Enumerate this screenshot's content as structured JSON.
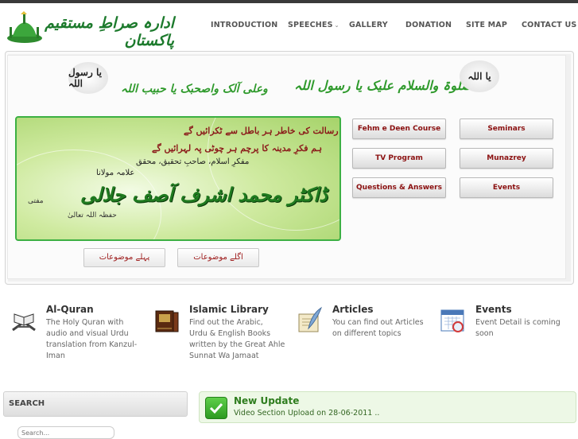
{
  "header": {
    "logo_text": "ادارہ صراطِ مستقیم پاکستان",
    "nav": [
      {
        "label": "INTRODUCTION"
      },
      {
        "label": "SPEECHES",
        "has_caret": true
      },
      {
        "label": "GALLERY"
      },
      {
        "label": "DONATION"
      },
      {
        "label": "SITE MAP"
      },
      {
        "label": "CONTACT US"
      }
    ]
  },
  "calligraphy": {
    "right_seal": "یا اللہ",
    "line": "الصلوۃ والسلام علیک یا رسول اللہ",
    "line2": "وعلی آلک واصحبک یا حبیب اللہ",
    "left_seal": "یا رسول اللہ"
  },
  "banner": {
    "line1": "توحید و رسالت کی خاطر ہر باطل سے ٹکرائیں گے",
    "line2": "ہم فکرِ مدینہ کا پرچم ہر چوٹی پہ لہرائیں گے",
    "line3": "مفکرِ اسلام، صاحبِ تحقیق، محقق",
    "line4": "علامہ مولانا",
    "name": "ڈاکٹر محمد اشرف آصف جلالی",
    "side_right": "حفظہ اللہ تعالیٰ",
    "side_left": "مفتی"
  },
  "topic_buttons": {
    "prev": "پہلے موضوعات",
    "next": "اگلے موضوعات"
  },
  "grid_buttons": [
    "Fehm e Deen Course",
    "Seminars",
    "TV Program",
    "Munazrey",
    "Questions & Answers",
    "Events"
  ],
  "features": [
    {
      "title": "Al-Quran",
      "desc": [
        "The Holy Quran with",
        "audio and visual Urdu",
        "translation from Kanzul-",
        "Iman"
      ],
      "icon": "quran-icon"
    },
    {
      "title": "Islamic Library",
      "desc": [
        "Find out the Arabic,",
        "Urdu & English Books",
        "written by the Great Ahle",
        "Sunnat Wa Jamaat"
      ],
      "icon": "books-icon"
    },
    {
      "title": "Articles",
      "desc": [
        "You can find out Articles",
        "on different topics"
      ],
      "icon": "quill-icon"
    },
    {
      "title": "Events",
      "desc": [
        "Event Detail is coming",
        "soon"
      ],
      "icon": "calendar-icon"
    }
  ],
  "search": {
    "title": "SEARCH",
    "placeholder": "Search..."
  },
  "update": {
    "title": "New Update",
    "text": "Video Section Upload on 28-06-2011 .."
  },
  "colors": {
    "accent_green": "#2f9a2c",
    "button_text": "#8b1010",
    "nav_text": "#555555"
  }
}
